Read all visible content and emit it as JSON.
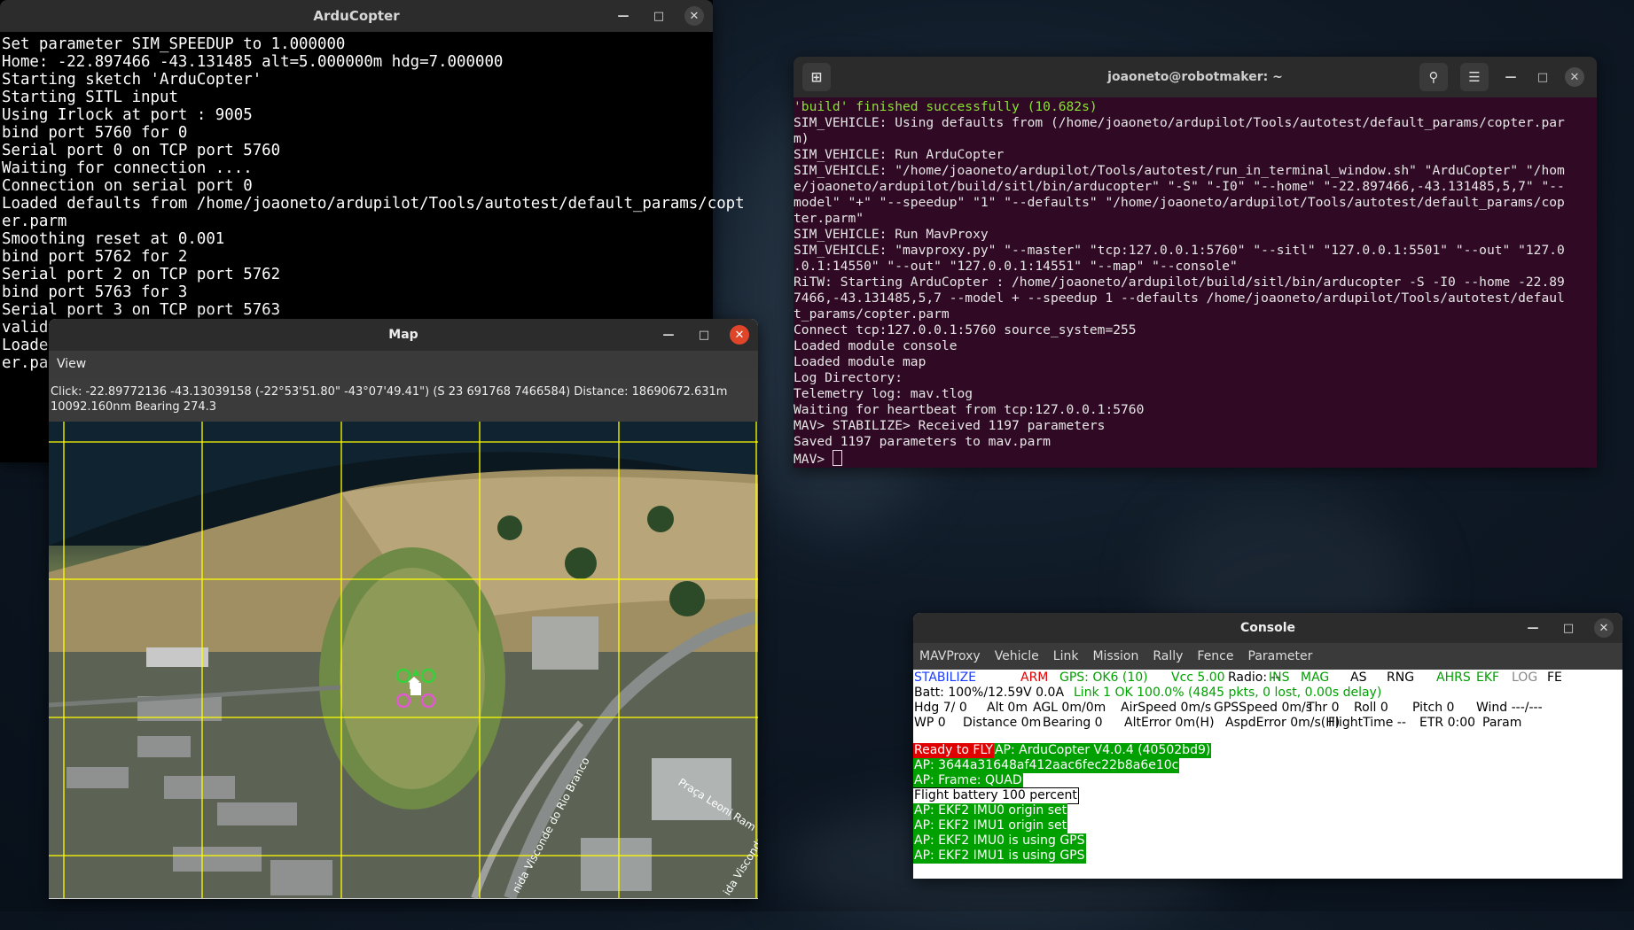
{
  "arducopter": {
    "title": "ArduCopter",
    "lines": [
      "Set parameter SIM_SPEEDUP to 1.000000",
      "Home: -22.897466 -43.131485 alt=5.000000m hdg=7.000000",
      "Starting sketch 'ArduCopter'",
      "Starting SITL input",
      "Using Irlock at port : 9005",
      "bind port 5760 for 0",
      "Serial port 0 on TCP port 5760",
      "Waiting for connection ....",
      "Connection on serial port 0",
      "Loaded defaults from /home/joaoneto/ardupilot/Tools/autotest/default_params/copt",
      "er.parm",
      "Smoothing reset at 0.001",
      "bind port 5762 for 2",
      "Serial port 2 on TCP port 5762",
      "bind port 5763 for 3",
      "Serial port 3 on TCP port 5763",
      "valid",
      "Loade",
      "er.par"
    ]
  },
  "terminal": {
    "title": "joaoneto@robotmaker: ~",
    "green_line": "'build' finished successfully (10.682s)",
    "lines": [
      "SIM_VEHICLE: Using defaults from (/home/joaoneto/ardupilot/Tools/autotest/default_params/copter.par",
      "m)",
      "SIM_VEHICLE: Run ArduCopter",
      "SIM_VEHICLE: \"/home/joaoneto/ardupilot/Tools/autotest/run_in_terminal_window.sh\" \"ArduCopter\" \"/hom",
      "e/joaoneto/ardupilot/build/sitl/bin/arducopter\" \"-S\" \"-I0\" \"--home\" \"-22.897466,-43.131485,5,7\" \"--",
      "model\" \"+\" \"--speedup\" \"1\" \"--defaults\" \"/home/joaoneto/ardupilot/Tools/autotest/default_params/cop",
      "ter.parm\"",
      "SIM_VEHICLE: Run MavProxy",
      "SIM_VEHICLE: \"mavproxy.py\" \"--master\" \"tcp:127.0.0.1:5760\" \"--sitl\" \"127.0.0.1:5501\" \"--out\" \"127.0",
      ".0.1:14550\" \"--out\" \"127.0.0.1:14551\" \"--map\" \"--console\"",
      "RiTW: Starting ArduCopter : /home/joaoneto/ardupilot/build/sitl/bin/arducopter -S -I0 --home -22.89",
      "7466,-43.131485,5,7 --model + --speedup 1 --defaults /home/joaoneto/ardupilot/Tools/autotest/defaul",
      "t_params/copter.parm",
      "Connect tcp:127.0.0.1:5760 source_system=255",
      "Loaded module console",
      "Loaded module map",
      "Log Directory:",
      "Telemetry log: mav.tlog",
      "Waiting for heartbeat from tcp:127.0.0.1:5760",
      "MAV> STABILIZE> Received 1197 parameters",
      "Saved 1197 parameters to mav.parm",
      "MAV> "
    ]
  },
  "map": {
    "title": "Map",
    "menu_view": "View",
    "status_line1": "Click: -22.89772136 -43.13039158 (-22°53'51.80\" -43°07'49.41\") (S 23 691768 7466584)  Distance: 18690672.631m",
    "status_line2": "10092.160nm Bearing 274.3",
    "street1": "Praça Leoni Ram",
    "street2": "nida Visconde do Rio Branco",
    "street3": "ida Visconde do"
  },
  "console": {
    "title": "Console",
    "menu": [
      "MAVProxy",
      "Vehicle",
      "Link",
      "Mission",
      "Rally",
      "Fence",
      "Parameter"
    ],
    "row1": [
      {
        "t": "STABILIZE",
        "c": "#1a3cff"
      },
      {
        "t": "ARM",
        "c": "#e00000"
      },
      {
        "t": "GPS: OK6 (10)",
        "c": "#00a000"
      },
      {
        "t": "Vcc 5.00",
        "c": "#00a000"
      },
      {
        "t": "Radio: --",
        "c": "#000"
      },
      {
        "t": "INS",
        "c": "#00a000"
      },
      {
        "t": "MAG",
        "c": "#00a000"
      },
      {
        "t": "AS",
        "c": "#000"
      },
      {
        "t": "RNG",
        "c": "#000"
      },
      {
        "t": "AHRS",
        "c": "#00a000"
      },
      {
        "t": "EKF",
        "c": "#00a000"
      },
      {
        "t": "LOG",
        "c": "#888"
      },
      {
        "t": "FE",
        "c": "#000"
      }
    ],
    "row2": [
      {
        "t": "Batt: 100%/12.59V 0.0A",
        "c": "#000"
      },
      {
        "t": "Link 1 OK 100.0% (4845 pkts, 0 lost, 0.00s delay)",
        "c": "#00a000"
      }
    ],
    "row3": [
      {
        "t": "Hdg  7/ 0",
        "c": "#000"
      },
      {
        "t": "Alt 0m",
        "c": "#000"
      },
      {
        "t": "AGL 0m/0m",
        "c": "#000"
      },
      {
        "t": "AirSpeed 0m/s",
        "c": "#000"
      },
      {
        "t": "GPSSpeed 0m/s",
        "c": "#000"
      },
      {
        "t": "Thr 0",
        "c": "#000"
      },
      {
        "t": "Roll 0",
        "c": "#000"
      },
      {
        "t": "Pitch 0",
        "c": "#000"
      },
      {
        "t": "Wind ---/---",
        "c": "#000"
      }
    ],
    "row4": [
      {
        "t": "WP 0",
        "c": "#000"
      },
      {
        "t": "Distance 0m",
        "c": "#000"
      },
      {
        "t": "Bearing 0",
        "c": "#000"
      },
      {
        "t": "AltError 0m(H)",
        "c": "#000"
      },
      {
        "t": "AspdError 0m/s(H)",
        "c": "#000"
      },
      {
        "t": "FlightTime --",
        "c": "#000"
      },
      {
        "t": "ETR 0:00",
        "c": "#000"
      },
      {
        "t": "Param",
        "c": "#000"
      }
    ],
    "ready": "Ready to FLY",
    "messages": [
      {
        "t": "AP: ArduCopter V4.0.4 (40502bd9)",
        "bg": "#00a000",
        "c": "#fff"
      },
      {
        "t": "AP: 3644a31648af412aac6fec22b8a6e10c",
        "bg": "#00a000",
        "c": "#fff"
      },
      {
        "t": "AP: Frame: QUAD",
        "bg": "#00a000",
        "c": "#fff"
      },
      {
        "t": "Flight battery 100 percent",
        "bg": "#fff",
        "c": "#000"
      },
      {
        "t": "AP: EKF2 IMU0 origin set",
        "bg": "#00a000",
        "c": "#fff"
      },
      {
        "t": "AP: EKF2 IMU1 origin set",
        "bg": "#00a000",
        "c": "#fff"
      },
      {
        "t": "AP: EKF2 IMU0 is using GPS",
        "bg": "#00a000",
        "c": "#fff"
      },
      {
        "t": "AP: EKF2 IMU1 is using GPS",
        "bg": "#00a000",
        "c": "#fff"
      }
    ]
  }
}
